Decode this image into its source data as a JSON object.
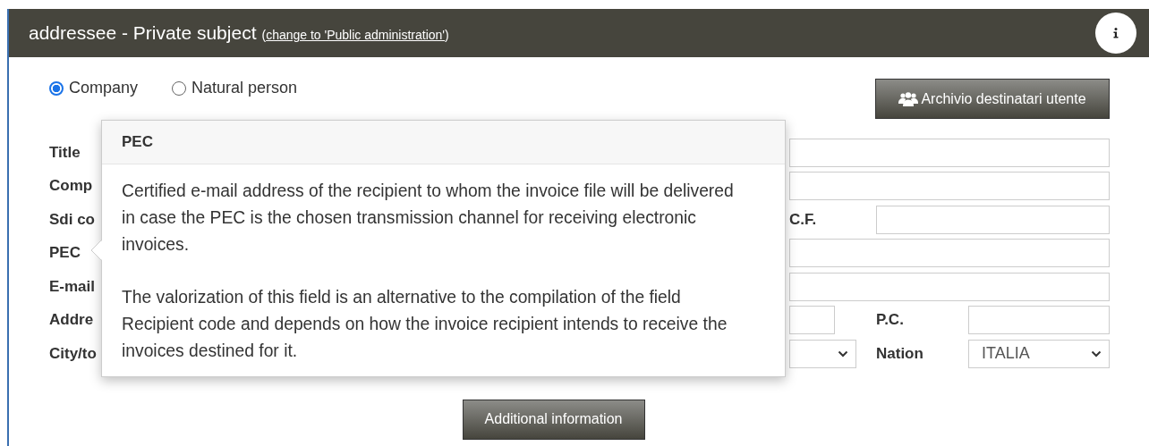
{
  "header": {
    "title": "addressee - Private subject",
    "note_open": "(",
    "link": "change to 'Public administration'",
    "note_close": ")"
  },
  "subject_types": [
    {
      "label": "Company",
      "selected": true
    },
    {
      "label": "Natural person",
      "selected": false
    }
  ],
  "archive_button": "Archivio destinatari utente",
  "rows": [
    {
      "label": "Title",
      "right": [
        {
          "kind": "input"
        }
      ]
    },
    {
      "label": "Comp",
      "right": [
        {
          "kind": "input"
        }
      ]
    },
    {
      "label": "Sdi co",
      "right": [
        {
          "kind": "label",
          "text": "C.F."
        },
        {
          "kind": "input"
        }
      ]
    },
    {
      "label": "PEC",
      "right": [
        {
          "kind": "input"
        }
      ]
    },
    {
      "label": "E-mail",
      "right": [
        {
          "kind": "input"
        }
      ]
    },
    {
      "label": "Addre",
      "right": [
        {
          "kind": "input"
        },
        {
          "kind": "label",
          "text": "P.C."
        },
        {
          "kind": "input"
        }
      ]
    },
    {
      "label": "City/to",
      "right": [
        {
          "kind": "select"
        },
        {
          "kind": "label",
          "text": "Nation"
        },
        {
          "kind": "select",
          "value": "ITALIA"
        }
      ]
    }
  ],
  "popover": {
    "title": "PEC",
    "paragraphs": [
      "Certified e-mail address of the recipient to whom the invoice file will be delivered in case the PEC is the chosen transmission channel for receiving electronic invoices.",
      "The valorization of this field is an alternative to the compilation of the field Recipient code and depends on how the invoice recipient intends to receive the invoices destined for it."
    ]
  },
  "additional_button": "Additional information"
}
